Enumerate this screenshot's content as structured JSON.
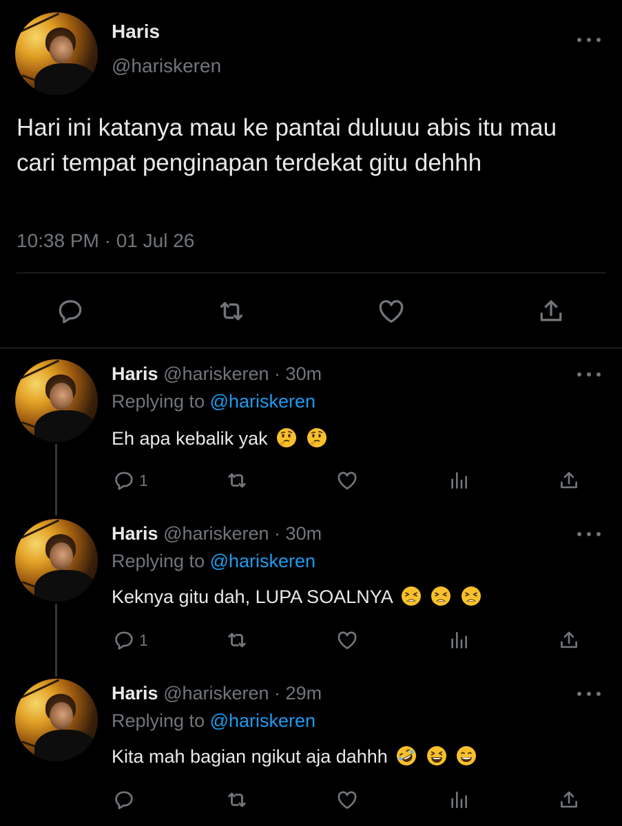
{
  "main_tweet": {
    "author_name": "Haris",
    "author_handle": "@hariskeren",
    "text": "Hari ini katanya mau ke pantai duluuu abis itu mau cari tempat penginapan terdekat gitu dehhh",
    "timestamp": "10:38 PM · 01 Jul 26",
    "actions": [
      "reply-icon",
      "retweet-icon",
      "like-icon",
      "share-icon"
    ]
  },
  "replies": [
    {
      "author_name": "Haris",
      "author_handle": "@hariskeren",
      "time": "30m",
      "replying_prefix": "Replying to ",
      "replying_to": "@hariskeren",
      "text": "Eh apa kebalik yak",
      "emojis": [
        "thinking-face",
        "thinking-face"
      ],
      "reply_count": "1"
    },
    {
      "author_name": "Haris",
      "author_handle": "@hariskeren",
      "time": "30m",
      "replying_prefix": "Replying to ",
      "replying_to": "@hariskeren",
      "text": "Keknya gitu dah, LUPA SOALNYA",
      "emojis": [
        "tired-face",
        "tired-face",
        "tired-face"
      ],
      "reply_count": "1"
    },
    {
      "author_name": "Haris",
      "author_handle": "@hariskeren",
      "time": "29m",
      "replying_prefix": "Replying to ",
      "replying_to": "@hariskeren",
      "text": "Kita mah bagian ngikut aja dahhh",
      "emojis": [
        "rolling-on-floor-laughing",
        "grinning-squinting-face",
        "beaming-face"
      ],
      "reply_count": ""
    }
  ],
  "colors": {
    "background": "#000000",
    "primary_text": "#e7e9ea",
    "secondary_text": "#71767b",
    "link": "#1d9bf0",
    "divider": "#2f3336"
  }
}
